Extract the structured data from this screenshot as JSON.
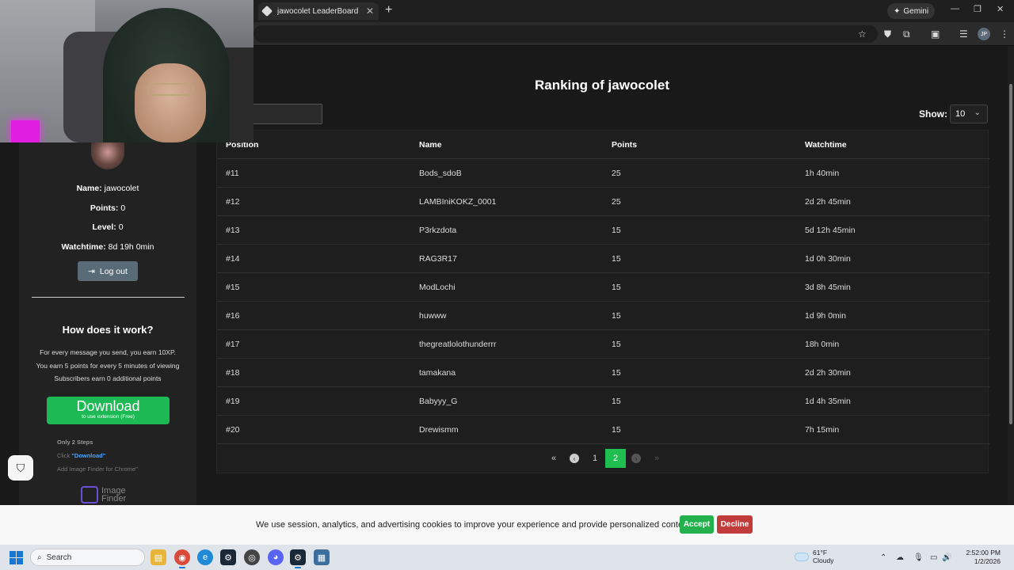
{
  "browser": {
    "tab_title": "jawocolet LeaderBoard | The be",
    "gemini_label": "Gemini",
    "profile_initials": "JP"
  },
  "page": {
    "heading": "Ranking of jawocolet",
    "show_label": "Show:",
    "show_value": "10"
  },
  "table": {
    "headers": [
      "Position",
      "Name",
      "Points",
      "Watchtime"
    ],
    "rows": [
      {
        "position": "#11",
        "name": "Bods_sdoB",
        "points": "25",
        "watchtime": "1h 40min"
      },
      {
        "position": "#12",
        "name": "LAMBIniKOKZ_0001",
        "points": "25",
        "watchtime": "2d 2h 45min"
      },
      {
        "position": "#13",
        "name": "P3rkzdota",
        "points": "15",
        "watchtime": "5d 12h 45min"
      },
      {
        "position": "#14",
        "name": "RAG3R17",
        "points": "15",
        "watchtime": "1d 0h 30min"
      },
      {
        "position": "#15",
        "name": "ModLochi",
        "points": "15",
        "watchtime": "3d 8h 45min"
      },
      {
        "position": "#16",
        "name": "huwww",
        "points": "15",
        "watchtime": "1d 9h 0min"
      },
      {
        "position": "#17",
        "name": "thegreatlolothunderrr",
        "points": "15",
        "watchtime": "18h 0min"
      },
      {
        "position": "#18",
        "name": "tamakana",
        "points": "15",
        "watchtime": "2d 2h 30min"
      },
      {
        "position": "#19",
        "name": "Babyyy_G",
        "points": "15",
        "watchtime": "1d 4h 35min"
      },
      {
        "position": "#20",
        "name": "Drewismm",
        "points": "15",
        "watchtime": "7h 15min"
      }
    ]
  },
  "pagination": {
    "pages": [
      "1",
      "2"
    ],
    "current": "2"
  },
  "sidebar": {
    "name_label": "Name:",
    "name_value": "jawocolet",
    "points_label": "Points:",
    "points_value": "0",
    "level_label": "Level:",
    "level_value": "0",
    "watchtime_label": "Watchtime:",
    "watchtime_value": "8d 19h 0min",
    "logout_label": "Log out",
    "how_title": "How does it work?",
    "how_lines": [
      "For every message you send, you earn 10XP.",
      "You earn 5 points for every 5 minutes of viewing",
      "Subscribers earn 0 additional points"
    ]
  },
  "ad": {
    "download_label": "Download",
    "download_sub": "to use extension (Free)",
    "steps_title": "Only 2 Steps",
    "step1_prefix": "Click",
    "step1_link": "\"Download\"",
    "step2": "Add Image Finder for Chrome\"",
    "brand_line1": "Image",
    "brand_line2": "Finder"
  },
  "cookie": {
    "text": "We use session, analytics, and advertising cookies to improve your experience and provide personalized content.",
    "accept_label": "Accept",
    "decline_label": "Decline"
  },
  "taskbar": {
    "search_label": "Search",
    "weather_temp": "61°F",
    "weather_desc": "Cloudy",
    "time": "2:52:00 PM",
    "date": "1/2/2026"
  },
  "colors": {
    "accent_green": "#1fbf4f",
    "logout_bg": "#5a6b78",
    "decline_red": "#c23b3b"
  }
}
